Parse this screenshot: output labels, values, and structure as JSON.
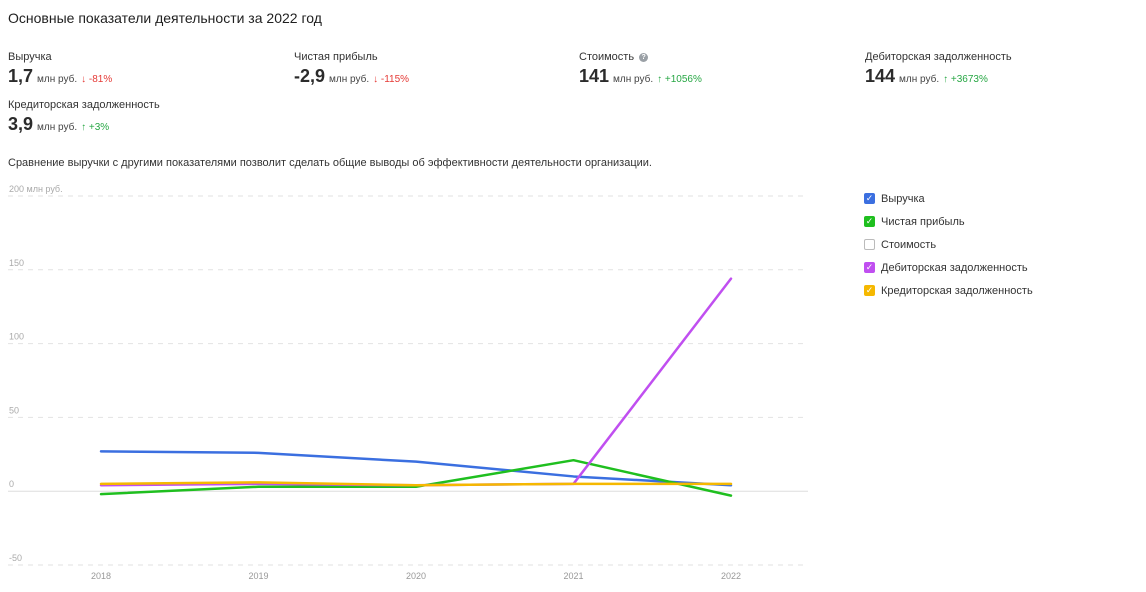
{
  "page": {
    "title": "Основные показатели деятельности за 2022 год",
    "description": "Сравнение выручки с другими показателями позволит сделать общие выводы об эффективности деятельности организации."
  },
  "metrics": [
    {
      "label": "Выручка",
      "value": "1,7",
      "unit": "млн руб.",
      "change": "↓ -81%",
      "trend": "down",
      "help": false
    },
    {
      "label": "Чистая прибыль",
      "value": "-2,9",
      "unit": "млн руб.",
      "change": "↓ -115%",
      "trend": "down",
      "help": false
    },
    {
      "label": "Стоимость",
      "value": "141",
      "unit": "млн руб.",
      "change": "↑ +1056%",
      "trend": "up",
      "help": true
    },
    {
      "label": "Дебиторская задолженность",
      "value": "144",
      "unit": "млн руб.",
      "change": "↑ +3673%",
      "trend": "up",
      "help": false
    },
    {
      "label": "Кредиторская задолженность",
      "value": "3,9",
      "unit": "млн руб.",
      "change": "↑ +3%",
      "trend": "up",
      "help": false
    }
  ],
  "chart_data": {
    "type": "line",
    "x": [
      "2018",
      "2019",
      "2020",
      "2021",
      "2022"
    ],
    "ytick_labels": [
      "200 млн руб.",
      "150",
      "100",
      "50",
      "0",
      "-50"
    ],
    "yticks": [
      200,
      150,
      100,
      50,
      0,
      -50
    ],
    "ylim": [
      -50,
      200
    ],
    "grid": true,
    "legend_position": "right",
    "series": [
      {
        "name": "Выручка",
        "color": "#3b6fe0",
        "enabled": true,
        "values": [
          27,
          26,
          20,
          10,
          4
        ]
      },
      {
        "name": "Чистая прибыль",
        "color": "#1fbf1f",
        "enabled": true,
        "values": [
          -2,
          3,
          3,
          21,
          -3
        ]
      },
      {
        "name": "Стоимость",
        "color": "#999999",
        "enabled": false,
        "values": []
      },
      {
        "name": "Дебиторская задолженность",
        "color": "#c04ff0",
        "enabled": true,
        "values": [
          4,
          5,
          4,
          5,
          144
        ]
      },
      {
        "name": "Кредиторская задолженность",
        "color": "#f5b800",
        "enabled": true,
        "values": [
          5,
          6,
          4,
          5,
          5
        ]
      }
    ]
  },
  "icons": {
    "help": "question-circle-icon",
    "check": "checkmark-icon"
  }
}
